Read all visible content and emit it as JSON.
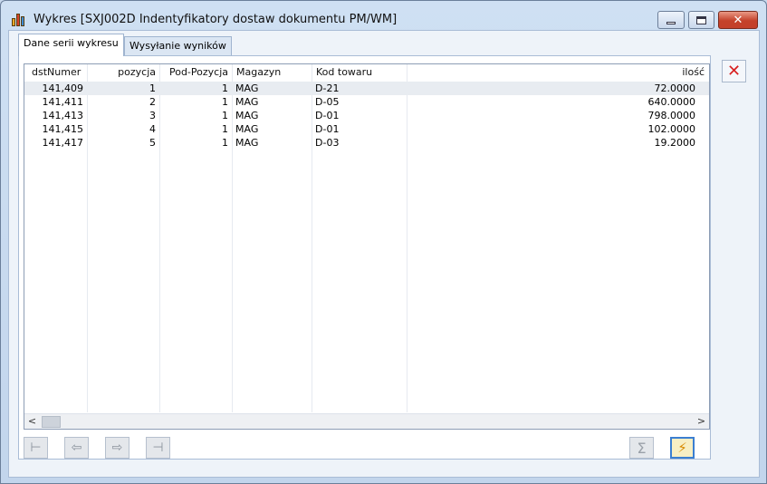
{
  "window": {
    "title": "Wykres [SXJ002D Indentyfikatory dostaw dokumentu PM/WM]",
    "close_glyph": "✕"
  },
  "tabs": [
    {
      "label": "Dane serii wykresu",
      "active": true
    },
    {
      "label": "Wysyłanie wyników",
      "active": false
    }
  ],
  "grid": {
    "columns": [
      "dstNumer",
      "pozycja",
      "Pod-Pozycja",
      "Magazyn",
      "Kod towaru",
      "ilość"
    ],
    "rows": [
      {
        "dstNumer": "141,409",
        "pozycja": "1",
        "podpozycja": "1",
        "magazyn": "MAG",
        "kod": "D-21",
        "ilosc": "72.0000",
        "selected": true
      },
      {
        "dstNumer": "141,411",
        "pozycja": "2",
        "podpozycja": "1",
        "magazyn": "MAG",
        "kod": "D-05",
        "ilosc": "640.0000",
        "selected": false
      },
      {
        "dstNumer": "141,413",
        "pozycja": "3",
        "podpozycja": "1",
        "magazyn": "MAG",
        "kod": "D-01",
        "ilosc": "798.0000",
        "selected": false
      },
      {
        "dstNumer": "141,415",
        "pozycja": "4",
        "podpozycja": "1",
        "magazyn": "MAG",
        "kod": "D-01",
        "ilosc": "102.0000",
        "selected": false
      },
      {
        "dstNumer": "141,417",
        "pozycja": "5",
        "podpozycja": "1",
        "magazyn": "MAG",
        "kod": "D-03",
        "ilosc": "19.2000",
        "selected": false
      }
    ]
  },
  "scroll": {
    "left": "<",
    "right": ">"
  },
  "nav": {
    "first": "⊢",
    "prev": "⇦",
    "next": "⇨",
    "last": "⊣",
    "sum": "Σ",
    "refresh": "⚡"
  },
  "side": {
    "close_glyph": "✕"
  },
  "colors": {
    "accent": "#3b7fd1",
    "close_red": "#d82020",
    "selected_row": "#e8ecf1"
  },
  "icons": [
    "chart-icon",
    "minimize-icon",
    "maximize-icon",
    "close-icon",
    "first-record-icon",
    "prev-record-icon",
    "next-record-icon",
    "last-record-icon",
    "sum-icon",
    "refresh-icon"
  ]
}
